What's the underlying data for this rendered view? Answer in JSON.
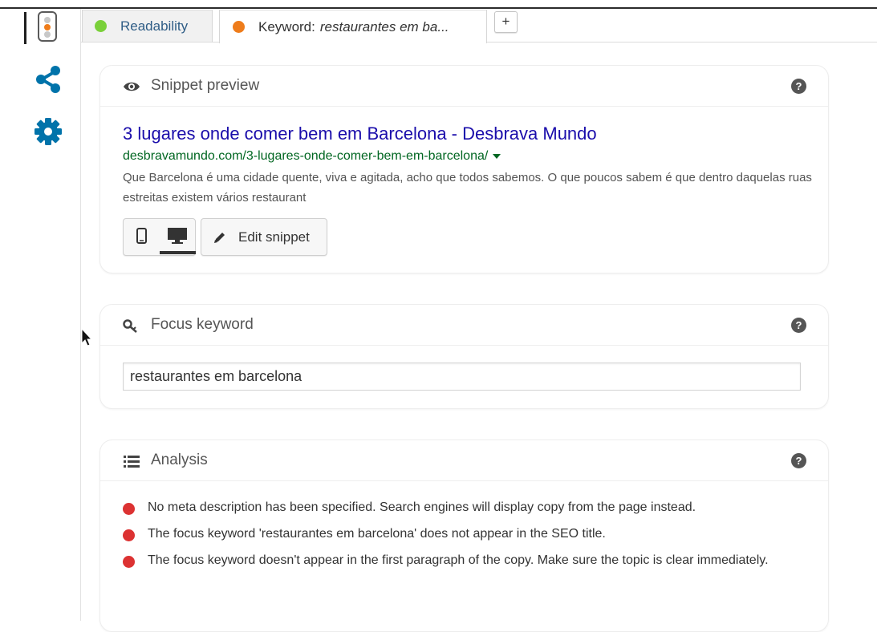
{
  "colors": {
    "good": "#7ad03a",
    "ok": "#ee7c1b",
    "bad": "#dc3232",
    "brand": "#0073aa"
  },
  "sidebar": {
    "items": [
      {
        "name": "traffic-light-icon",
        "active": true
      },
      {
        "name": "share-icon"
      },
      {
        "name": "gear-icon"
      }
    ]
  },
  "tabs": [
    {
      "label": "Readability",
      "status": "good"
    },
    {
      "label_prefix": "Keyword:",
      "label_keyword": "restaurantes em ba...",
      "status": "ok",
      "active": true
    }
  ],
  "add_tab_label": "+",
  "snippet": {
    "heading": "Snippet preview",
    "help": "?",
    "title": "3 lugares onde comer bem em Barcelona - Desbrava Mundo",
    "url": "desbravamundo.com/3-lugares-onde-comer-bem-em-barcelona/",
    "description": "Que Barcelona é uma cidade quente, viva e agitada, acho que todos sabemos. O que poucos sabem é que dentro daquelas ruas estreitas existem vários restaurant",
    "active_device": "desktop",
    "edit_label": "Edit snippet"
  },
  "focus": {
    "heading": "Focus keyword",
    "help": "?",
    "value": "restaurantes em barcelona"
  },
  "analysis": {
    "heading": "Analysis",
    "help": "?",
    "results": [
      {
        "status": "bad",
        "text": "No meta description has been specified. Search engines will display copy from the page instead."
      },
      {
        "status": "bad",
        "text": "The focus keyword 'restaurantes em barcelona' does not appear in the SEO title."
      },
      {
        "status": "bad",
        "text": "The focus keyword doesn't appear in the first paragraph of the copy. Make sure the topic is clear immediately."
      }
    ]
  }
}
